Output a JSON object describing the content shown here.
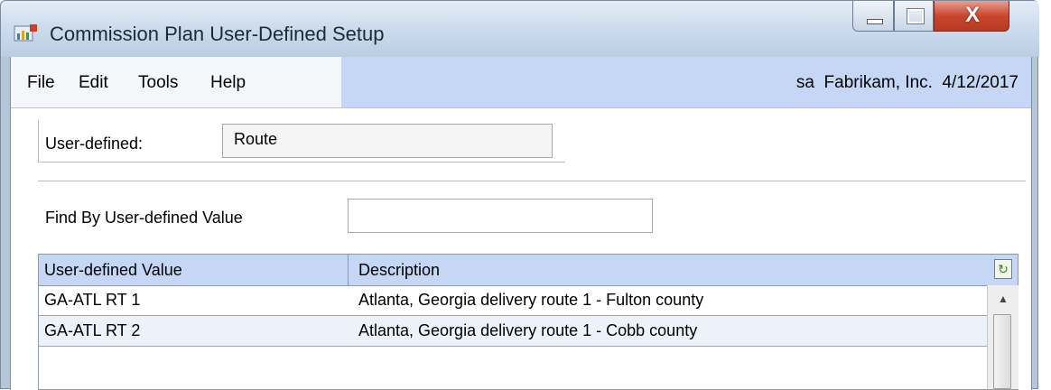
{
  "window": {
    "title": "Commission Plan User-Defined Setup",
    "close_glyph": "X"
  },
  "menu": {
    "items": [
      "File",
      "Edit",
      "Tools",
      "Help"
    ],
    "status": "sa  Fabrikam, Inc.  4/12/2017"
  },
  "form": {
    "user_defined_label": "User-defined:",
    "user_defined_value": "Route",
    "find_label": "Find By User-defined Value",
    "find_value": ""
  },
  "grid": {
    "columns": [
      "User-defined Value",
      "Description"
    ],
    "rows": [
      {
        "value": "GA-ATL RT 1",
        "description": "Atlanta, Georgia delivery route 1 - Fulton county"
      },
      {
        "value": "GA-ATL RT 2",
        "description": "Atlanta, Georgia delivery route 1 - Cobb county"
      },
      {
        "value": "",
        "description": ""
      }
    ],
    "refresh_icon": "refresh-icon",
    "scroll_up_glyph": "▲"
  },
  "colors": {
    "header_blue": "#c5d7f4",
    "alt_row": "#edf2fa",
    "close_red": "#c9462d"
  }
}
